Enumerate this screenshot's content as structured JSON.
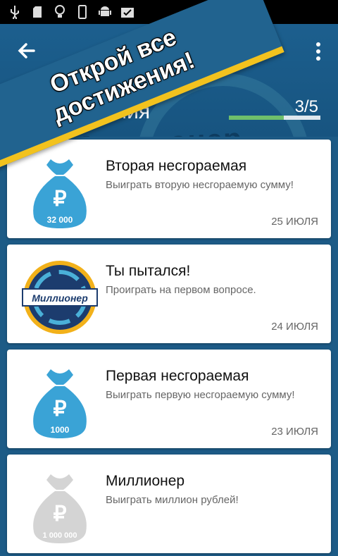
{
  "status_bar": {
    "icons": [
      "usb-icon",
      "sd-card-icon",
      "lightbulb-icon",
      "phone-icon",
      "android-icon",
      "clipboard-check-icon"
    ]
  },
  "toolbar": {
    "back_icon": "arrow-left-icon",
    "menu_icon": "more-vert-icon"
  },
  "banner": {
    "line1": "Открой все",
    "line2": "достижения!"
  },
  "header": {
    "title": "ижения",
    "progress_text": "3/5",
    "progress_fraction": 0.6,
    "watermark": "Миллионер"
  },
  "achievements": [
    {
      "title": "Вторая несгораемая",
      "description": "Выиграть вторую несгораемую сумму!",
      "date": "25 ИЮЛЯ",
      "icon": "money-bag-icon",
      "icon_label": "32 000",
      "locked": false
    },
    {
      "title": "Ты пытался!",
      "description": "Проиграть на первом вопросе.",
      "date": "24 ИЮЛЯ",
      "icon": "millionaire-logo-icon",
      "icon_label": "Миллионер",
      "locked": false
    },
    {
      "title": "Первая несгораемая",
      "description": "Выиграть первую несгораемую сумму!",
      "date": "23 ИЮЛЯ",
      "icon": "money-bag-icon",
      "icon_label": "1000",
      "locked": false
    },
    {
      "title": "Миллионер",
      "description": "Выиграть миллион рублей!",
      "date": "",
      "icon": "money-bag-locked-icon",
      "icon_label": "1 000 000",
      "locked": true
    }
  ],
  "colors": {
    "appbar": "#1c5f8e",
    "accent_yellow": "#f2c21e",
    "bag_blue": "#3aa3d6",
    "bag_locked": "#d4d4d4",
    "progress": "#6fbf6b"
  }
}
